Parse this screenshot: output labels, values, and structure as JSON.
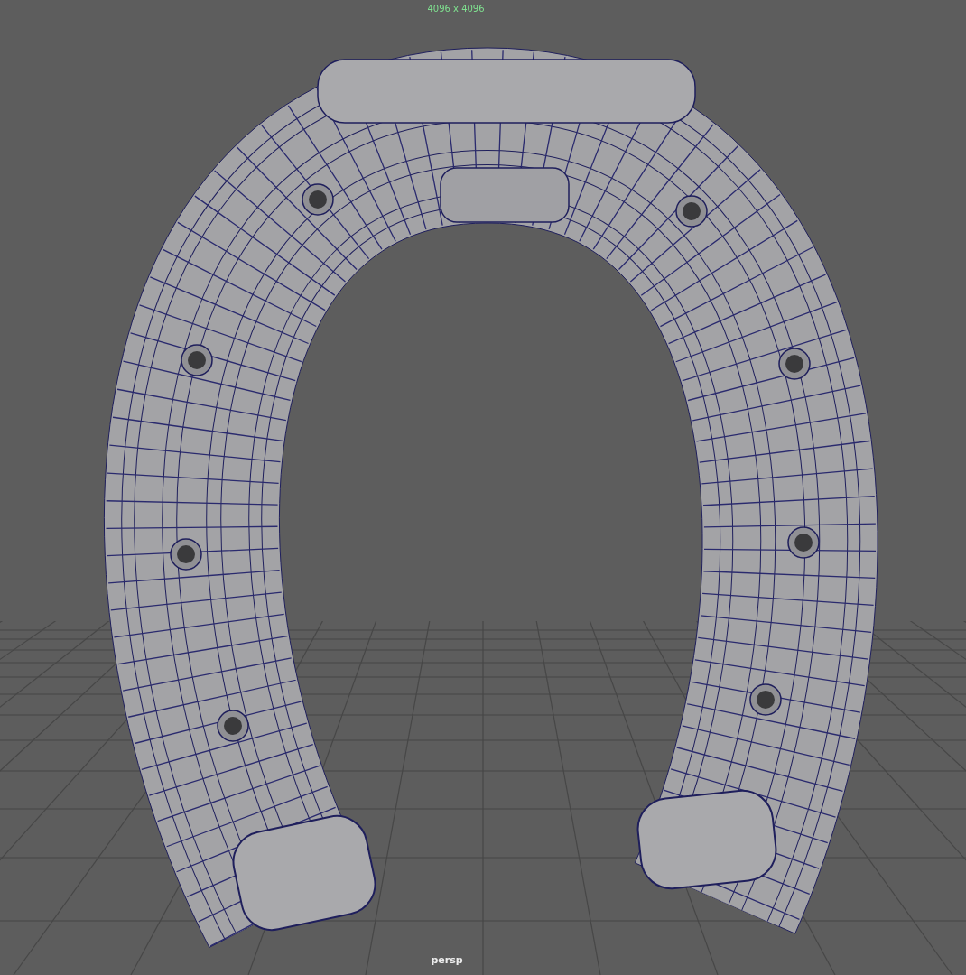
{
  "viewport": {
    "resolution_label": "4096 x 4096",
    "camera_label": "persp"
  }
}
